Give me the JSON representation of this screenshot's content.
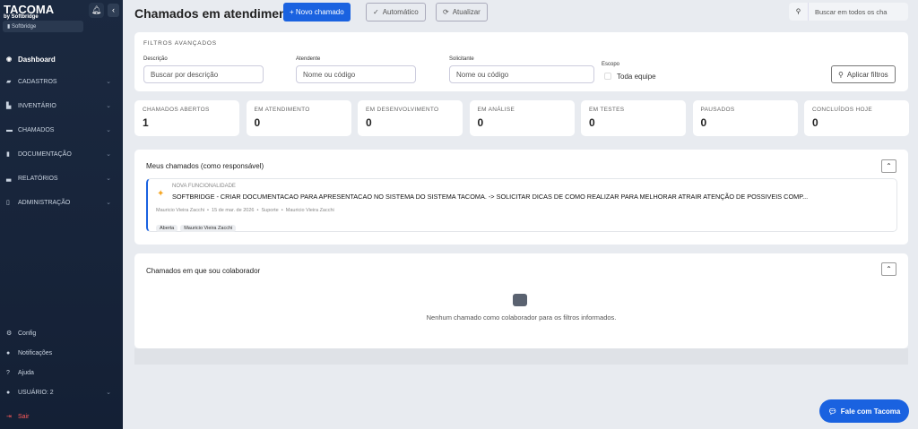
{
  "sidebar": {
    "brand": "TACOMA",
    "brand_sub": "by Softbridge",
    "org": "Softbridge",
    "items": [
      {
        "label": "Dashboard",
        "icon": "gauge-icon"
      },
      {
        "label": "CADASTROS",
        "icon": "folder-icon"
      },
      {
        "label": "INVENTÁRIO",
        "icon": "boxes-icon"
      },
      {
        "label": "CHAMADOS",
        "icon": "ticket-icon"
      },
      {
        "label": "DOCUMENTAÇÃO",
        "icon": "book-icon"
      },
      {
        "label": "RELATÓRIOS",
        "icon": "chart-icon"
      },
      {
        "label": "ADMINISTRAÇÃO",
        "icon": "building-icon"
      }
    ],
    "bottom": [
      {
        "label": "Config"
      },
      {
        "label": "Notificações"
      },
      {
        "label": "Ajuda"
      },
      {
        "label": "USUÁRIO: 2"
      },
      {
        "label": "Sair"
      }
    ]
  },
  "header": {
    "title": "Chamados em atendimento",
    "new_label": "+ Novo chamado",
    "auto_label": "Automático",
    "refresh_label": "Atualizar",
    "search_placeholder": "Buscar em todos os cha"
  },
  "filters": {
    "title": "FILTROS AVANÇADOS",
    "desc_label": "Descrição",
    "desc_placeholder": "Buscar por descrição",
    "atend_label": "Atendente",
    "atend_placeholder": "Nome ou código",
    "solic_label": "Solicitante",
    "solic_placeholder": "Nome ou código",
    "scope_label": "Escopo",
    "scope_option": "Toda equipe",
    "apply_label": "Aplicar filtros"
  },
  "stats": [
    {
      "label": "CHAMADOS ABERTOS",
      "value": "1"
    },
    {
      "label": "EM ATENDIMENTO",
      "value": "0"
    },
    {
      "label": "EM DESENVOLVIMENTO",
      "value": "0"
    },
    {
      "label": "EM ANÁLISE",
      "value": "0"
    },
    {
      "label": "EM TESTES",
      "value": "0"
    },
    {
      "label": "PAUSADOS",
      "value": "0"
    },
    {
      "label": "CONCLUÍDOS HOJE",
      "value": "0"
    }
  ],
  "mine": {
    "title": "Meus chamados (como responsável)",
    "ticket": {
      "type": "NOVA FUNCIONALIDADE",
      "title": "SOFTBRIDGE - CRIAR DOCUMENTACAO PARA APRESENTACAO NO SISTEMA DO SISTEMA TACOMA. -> SOLICITAR DICAS DE COMO REALIZAR PARA MELHORAR ATRAIR ATENÇÃO DE POSSIVEIS COMP...",
      "meta": "Mauricio Vieira Zacchi  •  15 de mar. de 2026  •  Suporte  •  Mauricio Vieira Zacchi",
      "tags": [
        "Aberta",
        "Mauricio Vieira Zacchi"
      ]
    }
  },
  "collab": {
    "title": "Chamados em que sou colaborador",
    "empty": "Nenhum chamado como colaborador para os filtros informados."
  },
  "chat": {
    "label": "Fale com Tacoma"
  },
  "colors": {
    "primary": "#1a62e0",
    "sidebar": "#1b2940"
  }
}
